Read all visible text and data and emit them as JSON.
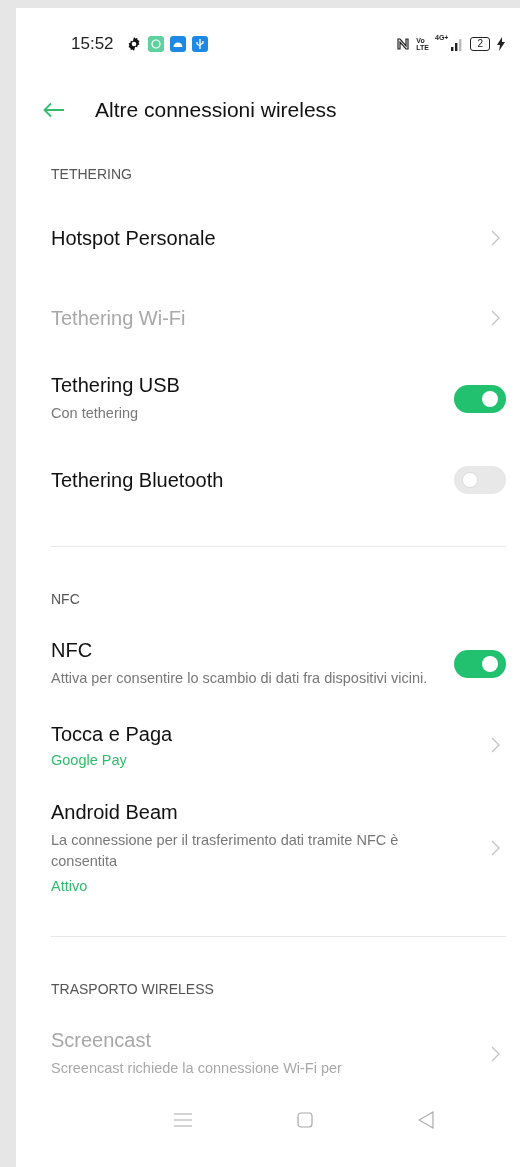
{
  "status_bar": {
    "time": "15:52",
    "volte": "Vo",
    "volte_sub": "LTE",
    "network": "4G+",
    "battery": "2"
  },
  "header": {
    "title": "Altre connessioni wireless"
  },
  "sections": [
    {
      "header": "TETHERING",
      "items": [
        {
          "title": "Hotspot Personale",
          "kind": "chevron",
          "disabled": false
        },
        {
          "title": "Tethering Wi-Fi",
          "kind": "chevron",
          "disabled": true
        },
        {
          "title": "Tethering USB",
          "description": "Con tethering",
          "kind": "toggle",
          "on": true,
          "disabled": false
        },
        {
          "title": "Tethering Bluetooth",
          "kind": "toggle",
          "on": false,
          "disabled": false
        }
      ]
    },
    {
      "header": "NFC",
      "items": [
        {
          "title": "NFC",
          "description": "Attiva per consentire lo scambio di dati fra dispositivi vicini.",
          "kind": "toggle",
          "on": true,
          "disabled": false
        },
        {
          "title": "Tocca e Paga",
          "status": "Google Pay",
          "kind": "chevron",
          "disabled": false
        },
        {
          "title": "Android Beam",
          "description": "La connessione per il trasferimento dati tramite NFC è consentita",
          "status": "Attivo",
          "kind": "chevron",
          "disabled": false
        }
      ]
    },
    {
      "header": "TRASPORTO WIRELESS",
      "items": [
        {
          "title": "Screencast",
          "description": "Screencast richiede la connessione Wi-Fi per",
          "kind": "chevron",
          "disabled": true
        }
      ]
    }
  ]
}
